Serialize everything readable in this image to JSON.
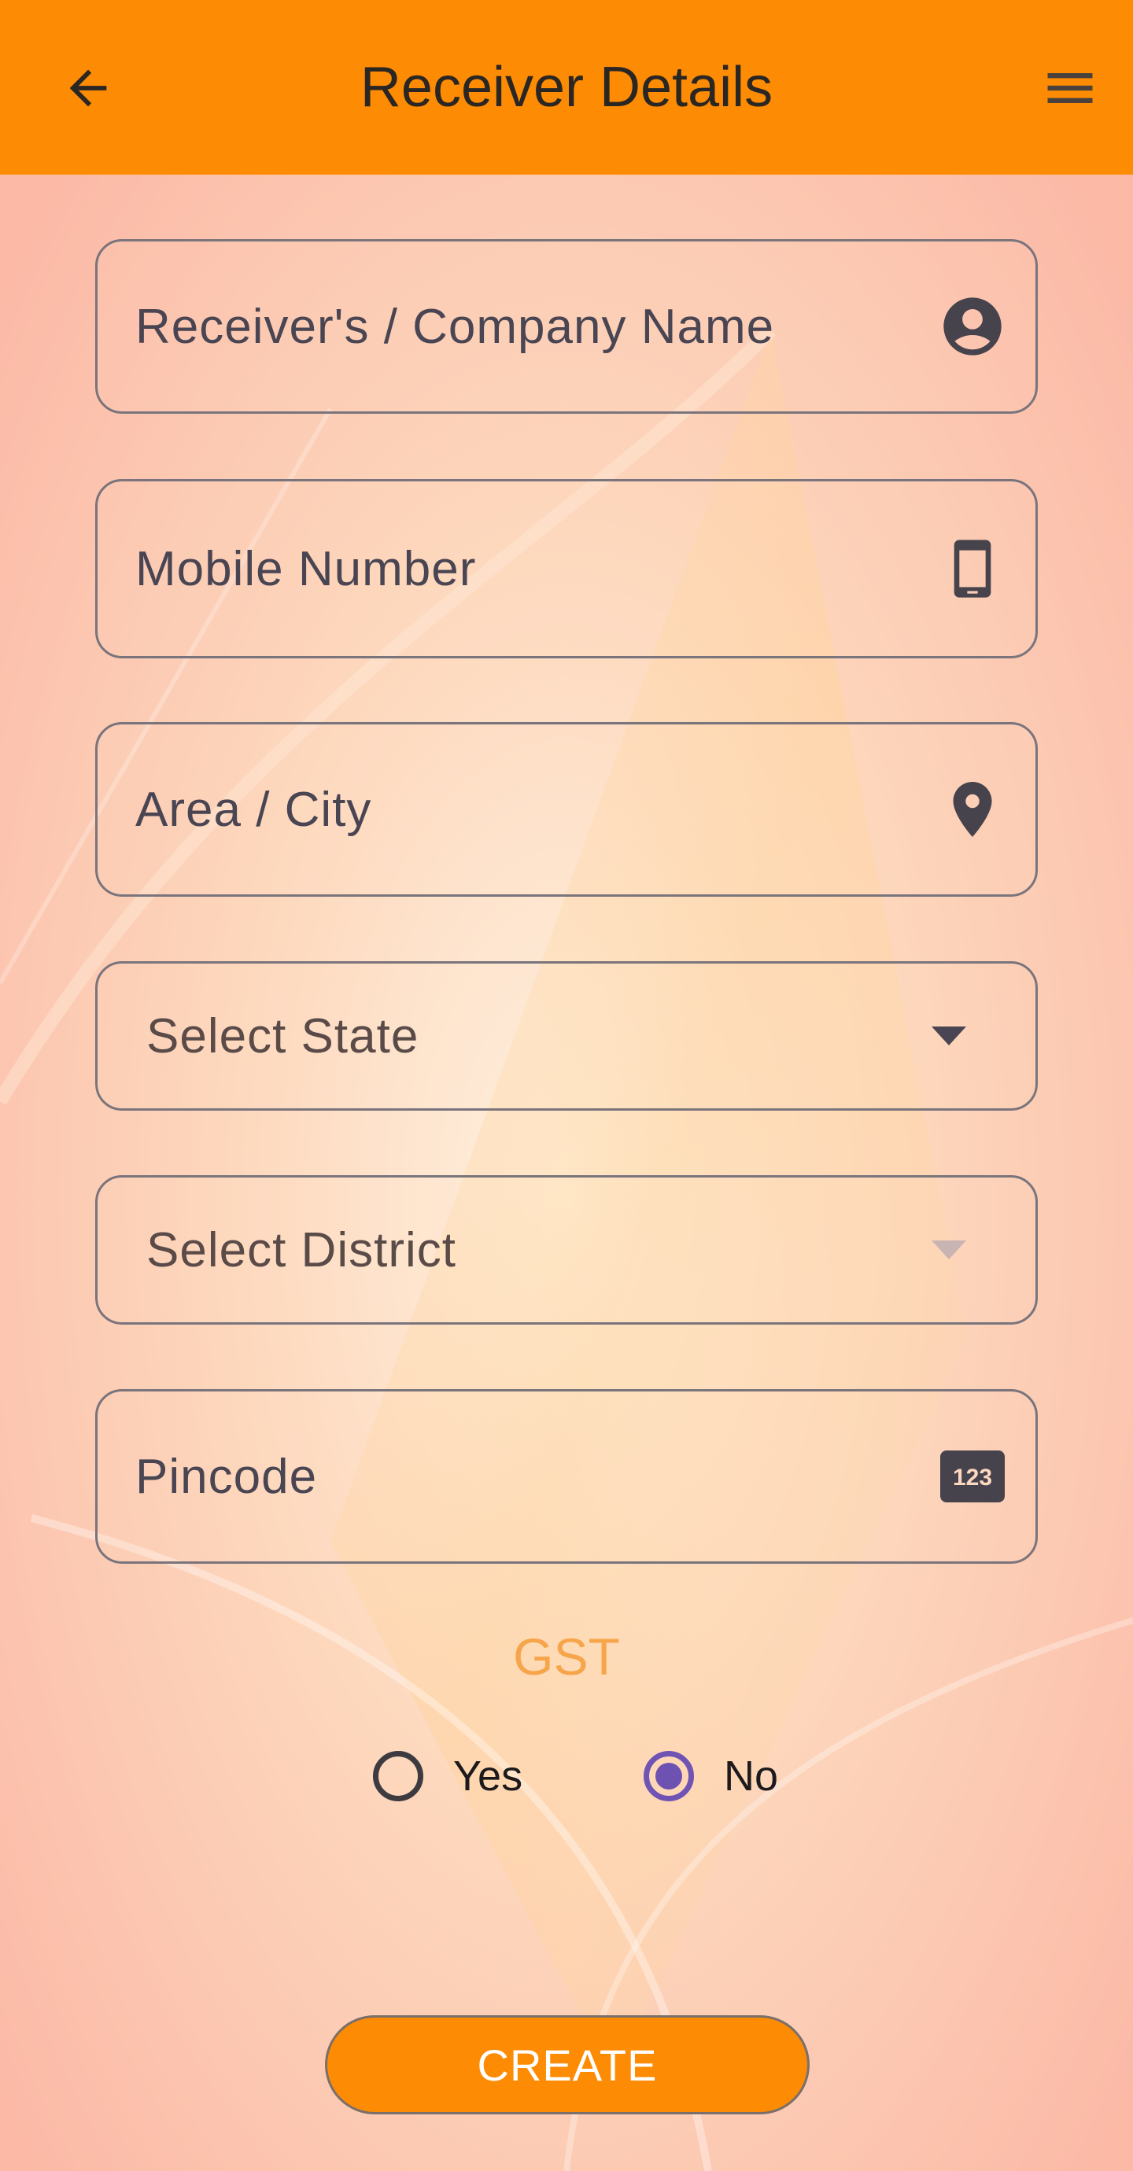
{
  "colors": {
    "app_bar": "#fd8b03",
    "background": "#fcc8b0",
    "title_text": "#2a2624",
    "field_border": "#7a747c",
    "field_label": "#4a4552",
    "gst_title": "#f7a54a",
    "radio_selected": "#6e52b2",
    "button": "#fd8b03",
    "button_text": "#ffffff"
  },
  "header": {
    "title": "Receiver Details",
    "back_icon": "arrow-left-icon",
    "menu_icon": "hamburger-menu-icon"
  },
  "form": {
    "name": {
      "placeholder": "Receiver's / Company Name",
      "value": "",
      "icon": "account-circle-icon"
    },
    "mobile": {
      "placeholder": "Mobile Number",
      "value": "",
      "icon": "smartphone-icon"
    },
    "city": {
      "placeholder": "Area / City",
      "value": "",
      "icon": "location-pin-icon"
    },
    "state": {
      "placeholder": "Select State",
      "value": "",
      "icon": "dropdown-arrow-icon"
    },
    "district": {
      "placeholder": "Select District",
      "value": "",
      "icon": "dropdown-arrow-icon"
    },
    "pincode": {
      "placeholder": "Pincode",
      "value": "",
      "icon": "numeric-123-icon",
      "icon_text": "123"
    }
  },
  "gst": {
    "title": "GST",
    "options": [
      {
        "label": "Yes",
        "selected": false
      },
      {
        "label": "No",
        "selected": true
      }
    ]
  },
  "actions": {
    "create_label": "CREATE"
  }
}
